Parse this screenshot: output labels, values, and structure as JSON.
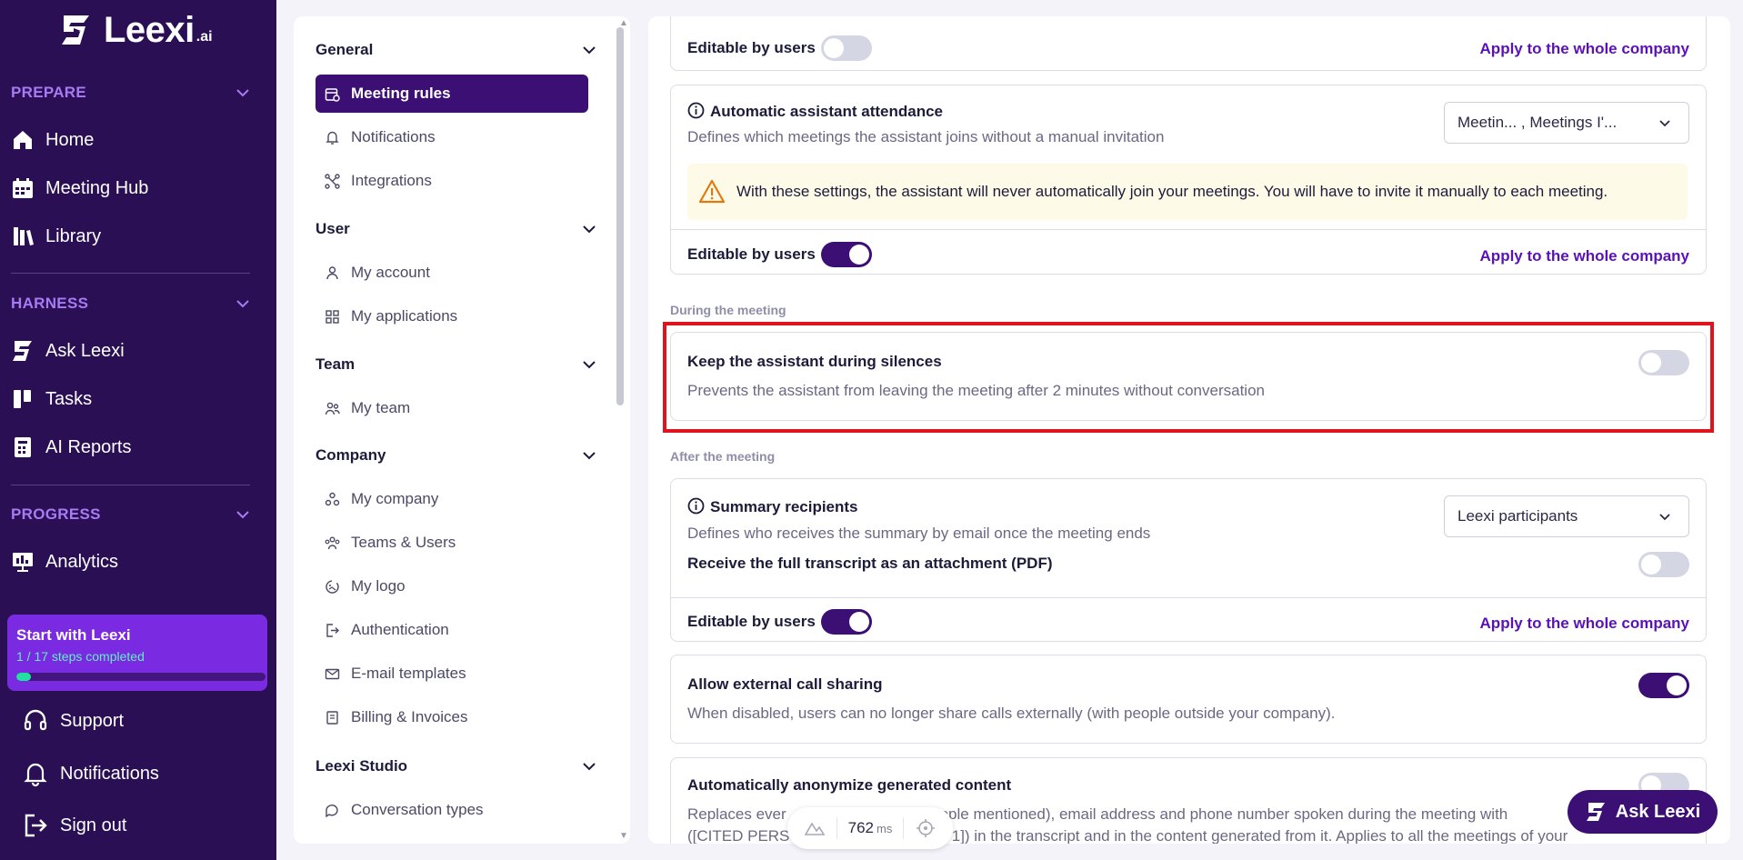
{
  "brand": {
    "name": "Leexi",
    "suffix": ".ai"
  },
  "sidebar": {
    "sections": [
      {
        "title": "PREPARE",
        "items": [
          "Home",
          "Meeting Hub",
          "Library"
        ]
      },
      {
        "title": "HARNESS",
        "items": [
          "Ask Leexi",
          "Tasks",
          "AI Reports"
        ]
      },
      {
        "title": "PROGRESS",
        "items": [
          "Analytics"
        ]
      }
    ],
    "start_card": {
      "title": "Start with Leexi",
      "steps": "1 / 17 steps completed",
      "progress": 0.059
    },
    "footer": [
      "Support",
      "Notifications",
      "Sign out"
    ]
  },
  "settings_nav": {
    "groups": [
      {
        "title": "General",
        "items": [
          "Meeting rules",
          "Notifications",
          "Integrations"
        ]
      },
      {
        "title": "User",
        "items": [
          "My account",
          "My applications"
        ]
      },
      {
        "title": "Team",
        "items": [
          "My team"
        ]
      },
      {
        "title": "Company",
        "items": [
          "My company",
          "Teams & Users",
          "My logo",
          "Authentication",
          "E-mail templates",
          "Billing & Invoices"
        ]
      },
      {
        "title": "Leexi Studio",
        "items": [
          "Conversation types"
        ]
      }
    ],
    "active_item": "Meeting rules"
  },
  "main": {
    "top_card": {
      "editable_label": "Editable by users",
      "editable_on": false,
      "apply_link": "Apply to the whole company"
    },
    "attendance": {
      "title": "Automatic assistant attendance",
      "description": "Defines which meetings the assistant joins without a manual invitation",
      "select_value": "Meetin... , Meetings I'...",
      "warning": "With these settings, the assistant will never automatically join your meetings. You will have to invite it manually to each meeting.",
      "editable_label": "Editable by users",
      "editable_on": true,
      "apply_link": "Apply to the whole company"
    },
    "during_label": "During the meeting",
    "silences": {
      "title": "Keep the assistant during silences",
      "description": "Prevents the assistant from leaving the meeting after 2 minutes without conversation",
      "on": false
    },
    "after_label": "After the meeting",
    "summary": {
      "title": "Summary recipients",
      "description": "Defines who receives the summary by email once the meeting ends",
      "select_value": "Leexi participants",
      "transcript_label": "Receive the full transcript as an attachment (PDF)",
      "transcript_on": false,
      "editable_label": "Editable by users",
      "editable_on": true,
      "apply_link": "Apply to the whole company"
    },
    "external": {
      "title": "Allow external call sharing",
      "description": "When disabled, users can no longer share calls externally (with people outside your company).",
      "on": true
    },
    "anonymize": {
      "title": "Automatically anonymize generated content",
      "description_line1": "Replaces ever",
      "description_line1b": "people mentioned), email address and phone number spoken during the meeting with",
      "description_line2": "([CITED PERS",
      "description_line2b": "NE 1]) in the transcript and in the content generated from it. Applies to all the meetings of your"
    }
  },
  "ask_button": "Ask Leexi",
  "perf": {
    "value": "762",
    "unit": "ms"
  },
  "colors": {
    "sidebar_bg": "#2a0f55",
    "accent": "#3b0f74",
    "link": "#5a12b8",
    "section_label": "#a77bf2",
    "highlight": "#e0141c"
  }
}
